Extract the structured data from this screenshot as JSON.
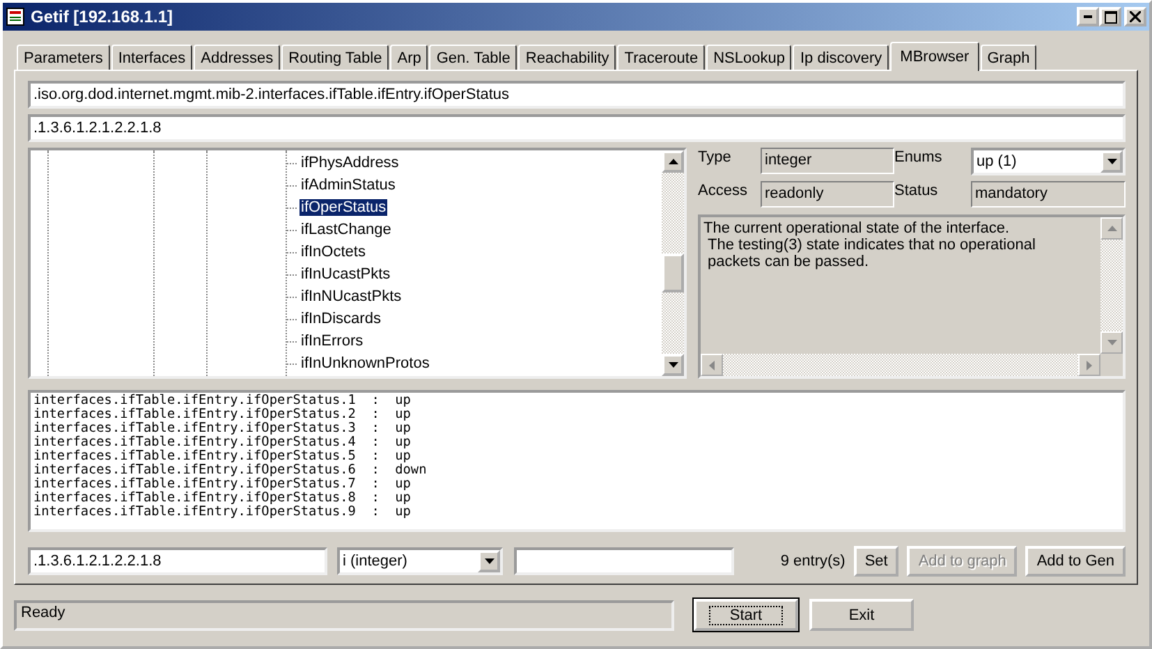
{
  "window": {
    "title": "Getif [192.168.1.1]"
  },
  "tabs": [
    {
      "label": "Parameters",
      "selected": false
    },
    {
      "label": "Interfaces",
      "selected": false
    },
    {
      "label": "Addresses",
      "selected": false
    },
    {
      "label": "Routing Table",
      "selected": false
    },
    {
      "label": "Arp",
      "selected": false
    },
    {
      "label": "Gen. Table",
      "selected": false
    },
    {
      "label": "Reachability",
      "selected": false
    },
    {
      "label": "Traceroute",
      "selected": false
    },
    {
      "label": "NSLookup",
      "selected": false
    },
    {
      "label": "Ip discovery",
      "selected": false
    },
    {
      "label": "MBrowser",
      "selected": true
    },
    {
      "label": "Graph",
      "selected": false
    }
  ],
  "oid_name": ".iso.org.dod.internet.mgmt.mib-2.interfaces.ifTable.ifEntry.ifOperStatus",
  "oid_number": ".1.3.6.1.2.1.2.2.1.8",
  "tree": {
    "items": [
      {
        "label": "ifPhysAddress",
        "selected": false
      },
      {
        "label": "ifAdminStatus",
        "selected": false
      },
      {
        "label": "ifOperStatus",
        "selected": true
      },
      {
        "label": "ifLastChange",
        "selected": false
      },
      {
        "label": "ifInOctets",
        "selected": false
      },
      {
        "label": "ifInUcastPkts",
        "selected": false
      },
      {
        "label": "ifInNUcastPkts",
        "selected": false
      },
      {
        "label": "ifInDiscards",
        "selected": false
      },
      {
        "label": "ifInErrors",
        "selected": false
      },
      {
        "label": "ifInUnknownProtos",
        "selected": false
      }
    ]
  },
  "details": {
    "type_label": "Type",
    "type": "integer",
    "enums_label": "Enums",
    "enums": "up (1)",
    "access_label": "Access",
    "access": "readonly",
    "status_label": "Status",
    "status": "mandatory",
    "description": [
      "The current operational state of the interface.",
      "The testing(3) state indicates that no operational",
      "packets can be passed."
    ]
  },
  "output": [
    "interfaces.ifTable.ifEntry.ifOperStatus.1  :  up",
    "interfaces.ifTable.ifEntry.ifOperStatus.2  :  up",
    "interfaces.ifTable.ifEntry.ifOperStatus.3  :  up",
    "interfaces.ifTable.ifEntry.ifOperStatus.4  :  up",
    "interfaces.ifTable.ifEntry.ifOperStatus.5  :  up",
    "interfaces.ifTable.ifEntry.ifOperStatus.6  :  down",
    "interfaces.ifTable.ifEntry.ifOperStatus.7  :  up",
    "interfaces.ifTable.ifEntry.ifOperStatus.8  :  up",
    "interfaces.ifTable.ifEntry.ifOperStatus.9  :  up"
  ],
  "set_row": {
    "oid": ".1.3.6.1.2.1.2.2.1.8",
    "value_type": "i (integer)",
    "count": "9 entry(s)",
    "buttons": [
      {
        "label": "Set",
        "disabled": false
      },
      {
        "label": "Add to graph",
        "disabled": true
      },
      {
        "label": "Add to Gen",
        "disabled": false
      }
    ]
  },
  "status_bar": "Ready",
  "buttons": [
    {
      "label": "Start",
      "default": true
    },
    {
      "label": "Exit",
      "default": false
    }
  ]
}
